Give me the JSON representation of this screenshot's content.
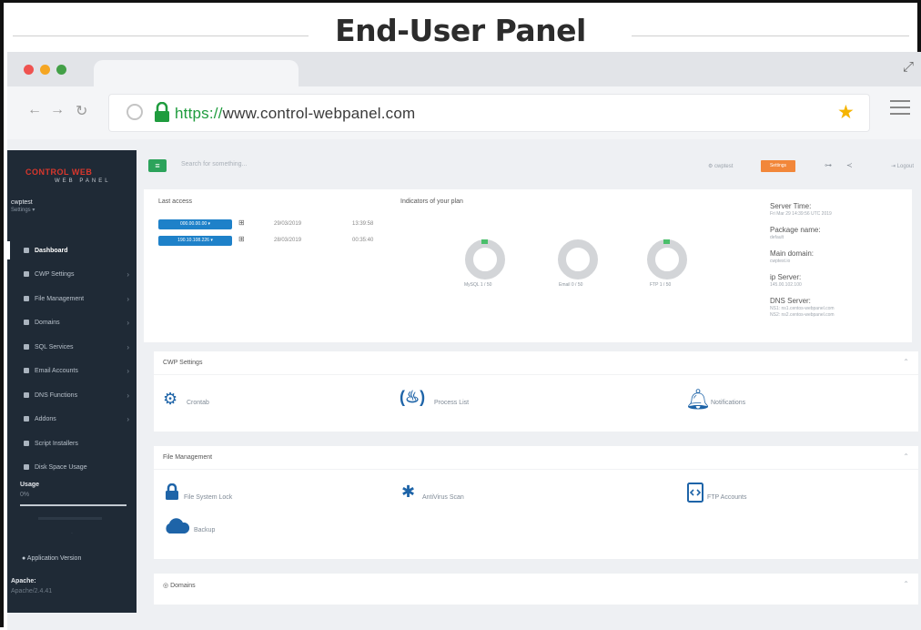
{
  "page": {
    "title": "End-User Panel"
  },
  "browser": {
    "url_scheme": "https://",
    "url_rest": "www.control-webpanel.com",
    "window_dots": [
      "#ef5350",
      "#f5a623",
      "#43a047"
    ]
  },
  "sidebar": {
    "logo_line1": "CONTROL WEB",
    "logo_line2": "WEB PANEL",
    "user": "cwptest",
    "user_sub": "Settings ▾",
    "items": [
      {
        "label": "Dashboard",
        "active": true
      },
      {
        "label": "CWP Settings"
      },
      {
        "label": "File Management"
      },
      {
        "label": "Domains"
      },
      {
        "label": "SQL Services"
      },
      {
        "label": "Email Accounts"
      },
      {
        "label": "DNS Functions"
      },
      {
        "label": "Addons"
      },
      {
        "label": "Script Installers"
      },
      {
        "label": "Disk Space Usage"
      }
    ],
    "usage_label": "Usage",
    "usage_pct": "0%",
    "app_version": "Application Version",
    "apache_label": "Apache:",
    "apache_version": "Apache/2.4.41"
  },
  "topbar": {
    "search_placeholder": "Search for something...",
    "user_menu": "cwptest",
    "badge": "Settings",
    "logout": "Logout"
  },
  "info": {
    "last_access_title": "Last access",
    "access_rows": [
      {
        "ip": "000.00.00.00 ▾",
        "date": "29/03/2019",
        "time": "13:39:58"
      },
      {
        "ip": "190.10.108.226 ▾",
        "date": "28/03/2019",
        "time": "00:35:40"
      }
    ],
    "indicators_title": "Indicators of your plan",
    "donuts": [
      {
        "label": "MySQL 1 / 50"
      },
      {
        "label": "Email 0 / 50"
      },
      {
        "label": "FTP 1 / 50"
      }
    ],
    "server": {
      "server_time_label": "Server Time:",
      "server_time_value": "Fri Mar 29 14:39:56 UTC 2019",
      "package_label": "Package name:",
      "package_value": "default",
      "main_domain_label": "Main domain:",
      "main_domain_value": "cwptest.io",
      "ip_label": "ip Server:",
      "ip_value": "145.00.102.100",
      "dns_label": "DNS Server:",
      "dns_value1": "NS1: ns1.centos-webpanel.com",
      "dns_value2": "NS2: ns2.centos-webpanel.com"
    }
  },
  "sections": [
    {
      "title": "CWP Settings",
      "tiles": [
        {
          "label": "Crontab"
        },
        {
          "label": "Process List"
        },
        {
          "label": "Notifications"
        }
      ]
    },
    {
      "title": "File Management",
      "tiles": [
        {
          "label": "File System Lock"
        },
        {
          "label": "AntiVirus Scan"
        },
        {
          "label": "FTP Accounts"
        },
        {
          "label": "Backup"
        }
      ]
    },
    {
      "title": "Domains",
      "tiles": []
    }
  ]
}
